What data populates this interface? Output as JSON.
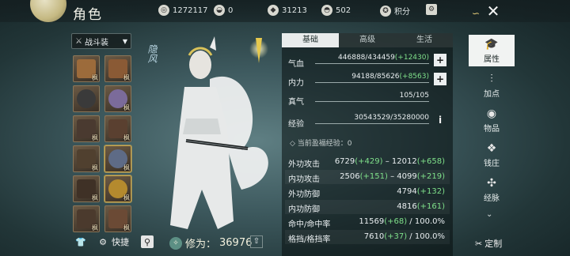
{
  "header": {
    "title": "角色",
    "currencies": [
      {
        "icon": "coin-bag-icon",
        "value": "1272117"
      },
      {
        "icon": "silver-ingot-icon",
        "value": "0"
      },
      {
        "icon": "jade-icon",
        "value": "31213"
      },
      {
        "icon": "gold-ingot-icon",
        "value": "502"
      }
    ],
    "points_label": "积分",
    "close_icon": "close-icon"
  },
  "equipment": {
    "dropdown_label": "战斗装",
    "slots": [
      {
        "label": "枫",
        "color": "#9c6b3b"
      },
      {
        "label": "枫",
        "color": "#8a5a35"
      },
      {
        "label": "",
        "color": "#3a3a3a"
      },
      {
        "label": "枫",
        "color": "#7b6b9a"
      },
      {
        "label": "枫",
        "color": "#4a3a30"
      },
      {
        "label": "枫",
        "color": "#5a4030"
      },
      {
        "label": "枫",
        "color": "#50402f"
      },
      {
        "label": "枫",
        "color": "#5e6b86"
      },
      {
        "label": "枫",
        "color": "#3f3126"
      },
      {
        "label": "枫",
        "color": "#b48a2e"
      },
      {
        "label": "枫",
        "color": "#4b3a2d"
      },
      {
        "label": "枫",
        "color": "#6b4a35"
      }
    ],
    "quick_label": "快捷"
  },
  "character": {
    "emblem": "隐风",
    "power_label": "修为：",
    "power_value": "36976"
  },
  "stats": {
    "tabs": [
      "基础",
      "高级",
      "生活"
    ],
    "bars": [
      {
        "name": "气血",
        "value": "446888/434459",
        "bonus": "(+12430)",
        "btn": "+"
      },
      {
        "name": "内力",
        "value": "94188/85626",
        "bonus": "(+8563)",
        "btn": "+"
      },
      {
        "name": "真气",
        "value": "105/105",
        "bonus": "",
        "btn": ""
      },
      {
        "name": "经验",
        "value": "30543529/35280000",
        "bonus": "",
        "btn": "i"
      }
    ],
    "hint": "当前盈福经验：0",
    "rows": [
      {
        "name": "外功攻击",
        "a": "6729",
        "ab": "(+429)",
        "sep": " – ",
        "b": "12012",
        "bb": "(+658)"
      },
      {
        "name": "内功攻击",
        "a": "2506",
        "ab": "(+151)",
        "sep": " – ",
        "b": "4099",
        "bb": "(+219)"
      },
      {
        "name": "外功防御",
        "a": "4794",
        "ab": "(+132)",
        "sep": "",
        "b": "",
        "bb": ""
      },
      {
        "name": "内功防御",
        "a": "4816",
        "ab": "(+161)",
        "sep": "",
        "b": "",
        "bb": ""
      },
      {
        "name": "命中/命中率",
        "a": "11569",
        "ab": "(+68)",
        "sep": " / ",
        "b": "100.0%",
        "bb": ""
      },
      {
        "name": "格挡/格挡率",
        "a": "7610",
        "ab": "(+37)",
        "sep": " / ",
        "b": "100.0%",
        "bb": ""
      }
    ]
  },
  "nav": {
    "items": [
      {
        "icon": "attribute-icon",
        "label": "属性"
      },
      {
        "icon": "addpoint-icon",
        "label": "加点"
      },
      {
        "icon": "items-icon",
        "label": "物品"
      },
      {
        "icon": "bank-icon",
        "label": "钱庄"
      },
      {
        "icon": "meridian-icon",
        "label": "经脉"
      }
    ],
    "custom_label": "定制"
  }
}
